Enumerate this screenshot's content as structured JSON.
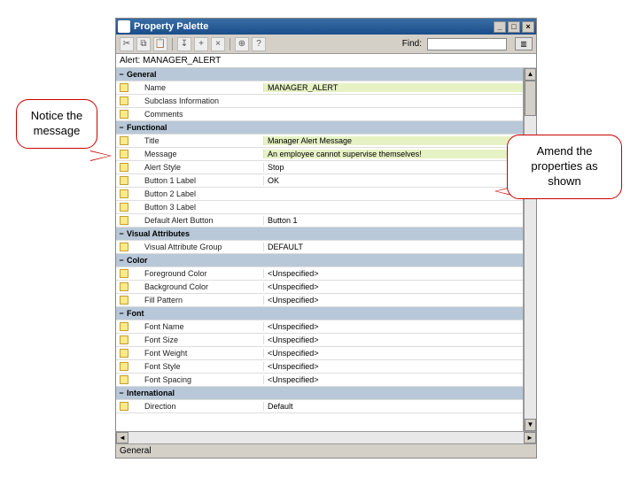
{
  "window": {
    "title": "Property Palette"
  },
  "toolbar": {
    "find_label": "Find:",
    "find_value": ""
  },
  "context": "Alert: MANAGER_ALERT",
  "sections": [
    {
      "name": "General",
      "props": [
        {
          "n": "Name",
          "v": "MANAGER_ALERT",
          "hl": true
        },
        {
          "n": "Subclass Information",
          "v": ""
        },
        {
          "n": "Comments",
          "v": ""
        }
      ]
    },
    {
      "name": "Functional",
      "props": [
        {
          "n": "Title",
          "v": "Manager Alert Message",
          "hl": true
        },
        {
          "n": "Message",
          "v": "An employee cannot supervise themselves!",
          "hl": true
        },
        {
          "n": "Alert Style",
          "v": "Stop"
        },
        {
          "n": "Button 1 Label",
          "v": "OK"
        },
        {
          "n": "Button 2 Label",
          "v": "",
          "hl": true
        },
        {
          "n": "Button 3 Label",
          "v": "",
          "hl": true
        },
        {
          "n": "Default Alert Button",
          "v": "Button 1"
        }
      ]
    },
    {
      "name": "Visual Attributes",
      "props": [
        {
          "n": "Visual Attribute Group",
          "v": "DEFAULT"
        }
      ]
    },
    {
      "name": "Color",
      "props": [
        {
          "n": "Foreground Color",
          "v": "<Unspecified>"
        },
        {
          "n": "Background Color",
          "v": "<Unspecified>"
        },
        {
          "n": "Fill Pattern",
          "v": "<Unspecified>"
        }
      ]
    },
    {
      "name": "Font",
      "props": [
        {
          "n": "Font Name",
          "v": "<Unspecified>"
        },
        {
          "n": "Font Size",
          "v": "<Unspecified>"
        },
        {
          "n": "Font Weight",
          "v": "<Unspecified>"
        },
        {
          "n": "Font Style",
          "v": "<Unspecified>"
        },
        {
          "n": "Font Spacing",
          "v": "<Unspecified>"
        }
      ]
    },
    {
      "name": "International",
      "props": [
        {
          "n": "Direction",
          "v": "Default"
        }
      ]
    }
  ],
  "status": "General",
  "callouts": {
    "left": "Notice the message",
    "right": "Amend the properties as shown"
  }
}
